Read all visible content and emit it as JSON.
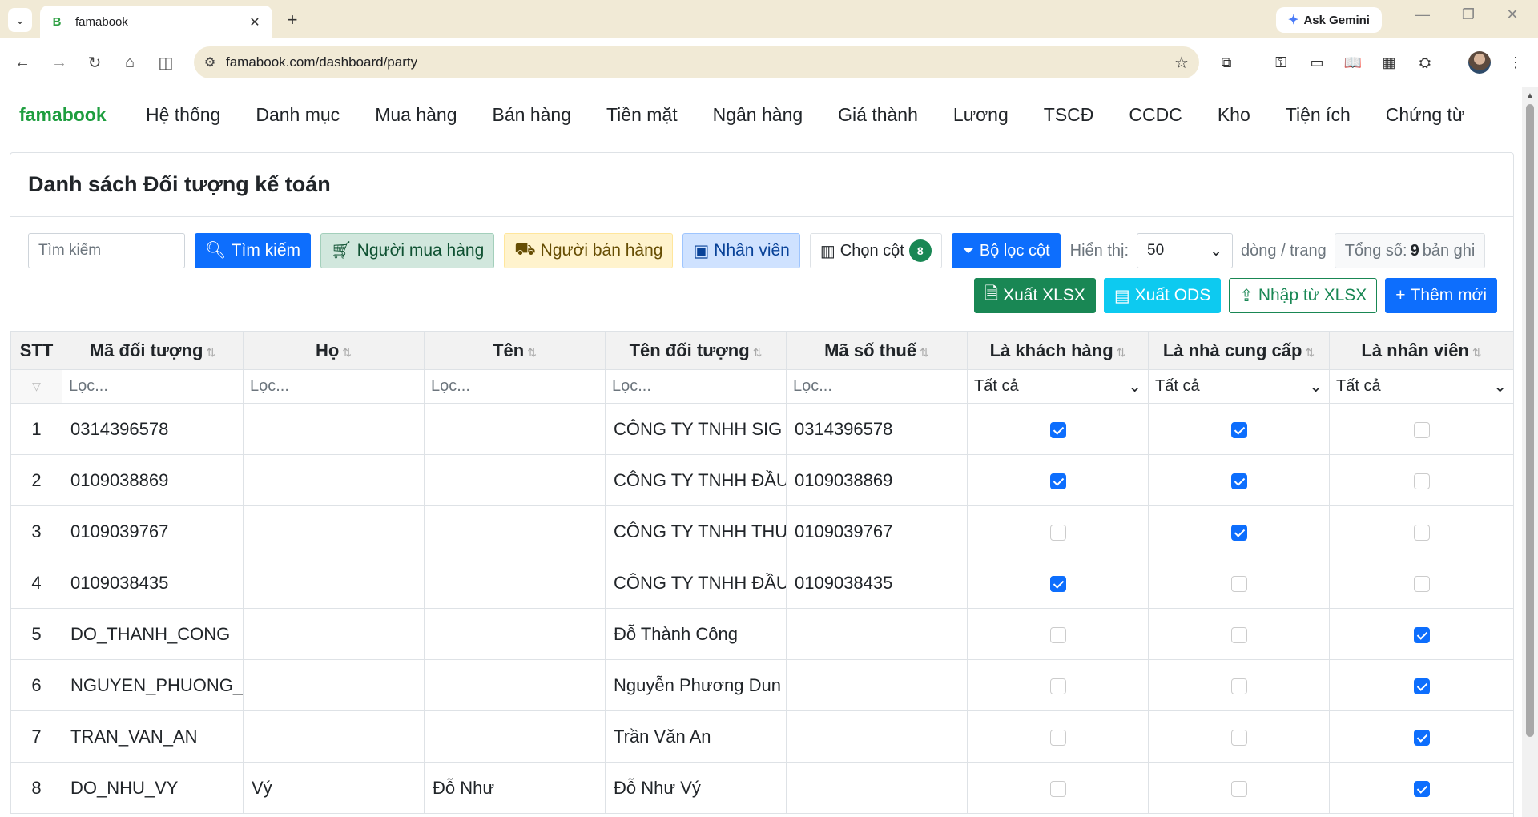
{
  "browser": {
    "tab_title": "famabook",
    "tab_favicon": "B",
    "url": "famabook.com/dashboard/party",
    "gemini_label": "Ask Gemini"
  },
  "app": {
    "brand": "famabook",
    "menu": [
      "Hệ thống",
      "Danh mục",
      "Mua hàng",
      "Bán hàng",
      "Tiền mặt",
      "Ngân hàng",
      "Giá thành",
      "Lương",
      "TSCĐ",
      "CCDC",
      "Kho",
      "Tiện ích",
      "Chứng từ"
    ]
  },
  "page": {
    "title": "Danh sách Đối tượng kế toán",
    "search_placeholder": "Tìm kiếm",
    "search_button": "Tìm kiếm",
    "buyer_button": "Người mua hàng",
    "seller_button": "Người bán hàng",
    "employee_button": "Nhân viên",
    "columns_button": "Chọn cột",
    "columns_count": "8",
    "column_filter_button": "Bộ lọc cột",
    "show_label": "Hiển thị:",
    "page_size": "50",
    "per_page_label": "dòng / trang",
    "total_prefix": "Tổng số:",
    "total_count": "9",
    "total_suffix": "bản ghi",
    "export_xlsx": "Xuất XLSX",
    "export_ods": "Xuất ODS",
    "import_xlsx": "Nhập từ XLSX",
    "add_new": "Thêm mới"
  },
  "table": {
    "headers": [
      "STT",
      "Mã đối tượng",
      "Họ",
      "Tên",
      "Tên đối tượng",
      "Mã số thuế",
      "Là khách hàng",
      "Là nhà cung cấp",
      "Là nhân viên"
    ],
    "filter_placeholder": "Lọc...",
    "filter_all": "Tất cả",
    "rows": [
      {
        "stt": "1",
        "code": "0314396578",
        "last": "",
        "first": "",
        "name": "CÔNG TY TNHH SIG",
        "tax": "0314396578",
        "customer": true,
        "supplier": true,
        "employee": false
      },
      {
        "stt": "2",
        "code": "0109038869",
        "last": "",
        "first": "",
        "name": "CÔNG TY TNHH ĐẦU",
        "tax": "0109038869",
        "customer": true,
        "supplier": true,
        "employee": false
      },
      {
        "stt": "3",
        "code": "0109039767",
        "last": "",
        "first": "",
        "name": "CÔNG TY TNHH THU",
        "tax": "0109039767",
        "customer": false,
        "supplier": true,
        "employee": false
      },
      {
        "stt": "4",
        "code": "0109038435",
        "last": "",
        "first": "",
        "name": "CÔNG TY TNHH ĐẦU",
        "tax": "0109038435",
        "customer": true,
        "supplier": false,
        "employee": false
      },
      {
        "stt": "5",
        "code": "DO_THANH_CONG",
        "last": "",
        "first": "",
        "name": "Đỗ Thành Công",
        "tax": "",
        "customer": false,
        "supplier": false,
        "employee": true
      },
      {
        "stt": "6",
        "code": "NGUYEN_PHUONG_",
        "last": "",
        "first": "",
        "name": "Nguyễn Phương Dun",
        "tax": "",
        "customer": false,
        "supplier": false,
        "employee": true
      },
      {
        "stt": "7",
        "code": "TRAN_VAN_AN",
        "last": "",
        "first": "",
        "name": "Trần Văn An",
        "tax": "",
        "customer": false,
        "supplier": false,
        "employee": true
      },
      {
        "stt": "8",
        "code": "DO_NHU_VY",
        "last": "Vý",
        "first": "Đỗ Như",
        "name": "Đỗ Như Vý",
        "tax": "",
        "customer": false,
        "supplier": false,
        "employee": true
      }
    ]
  }
}
